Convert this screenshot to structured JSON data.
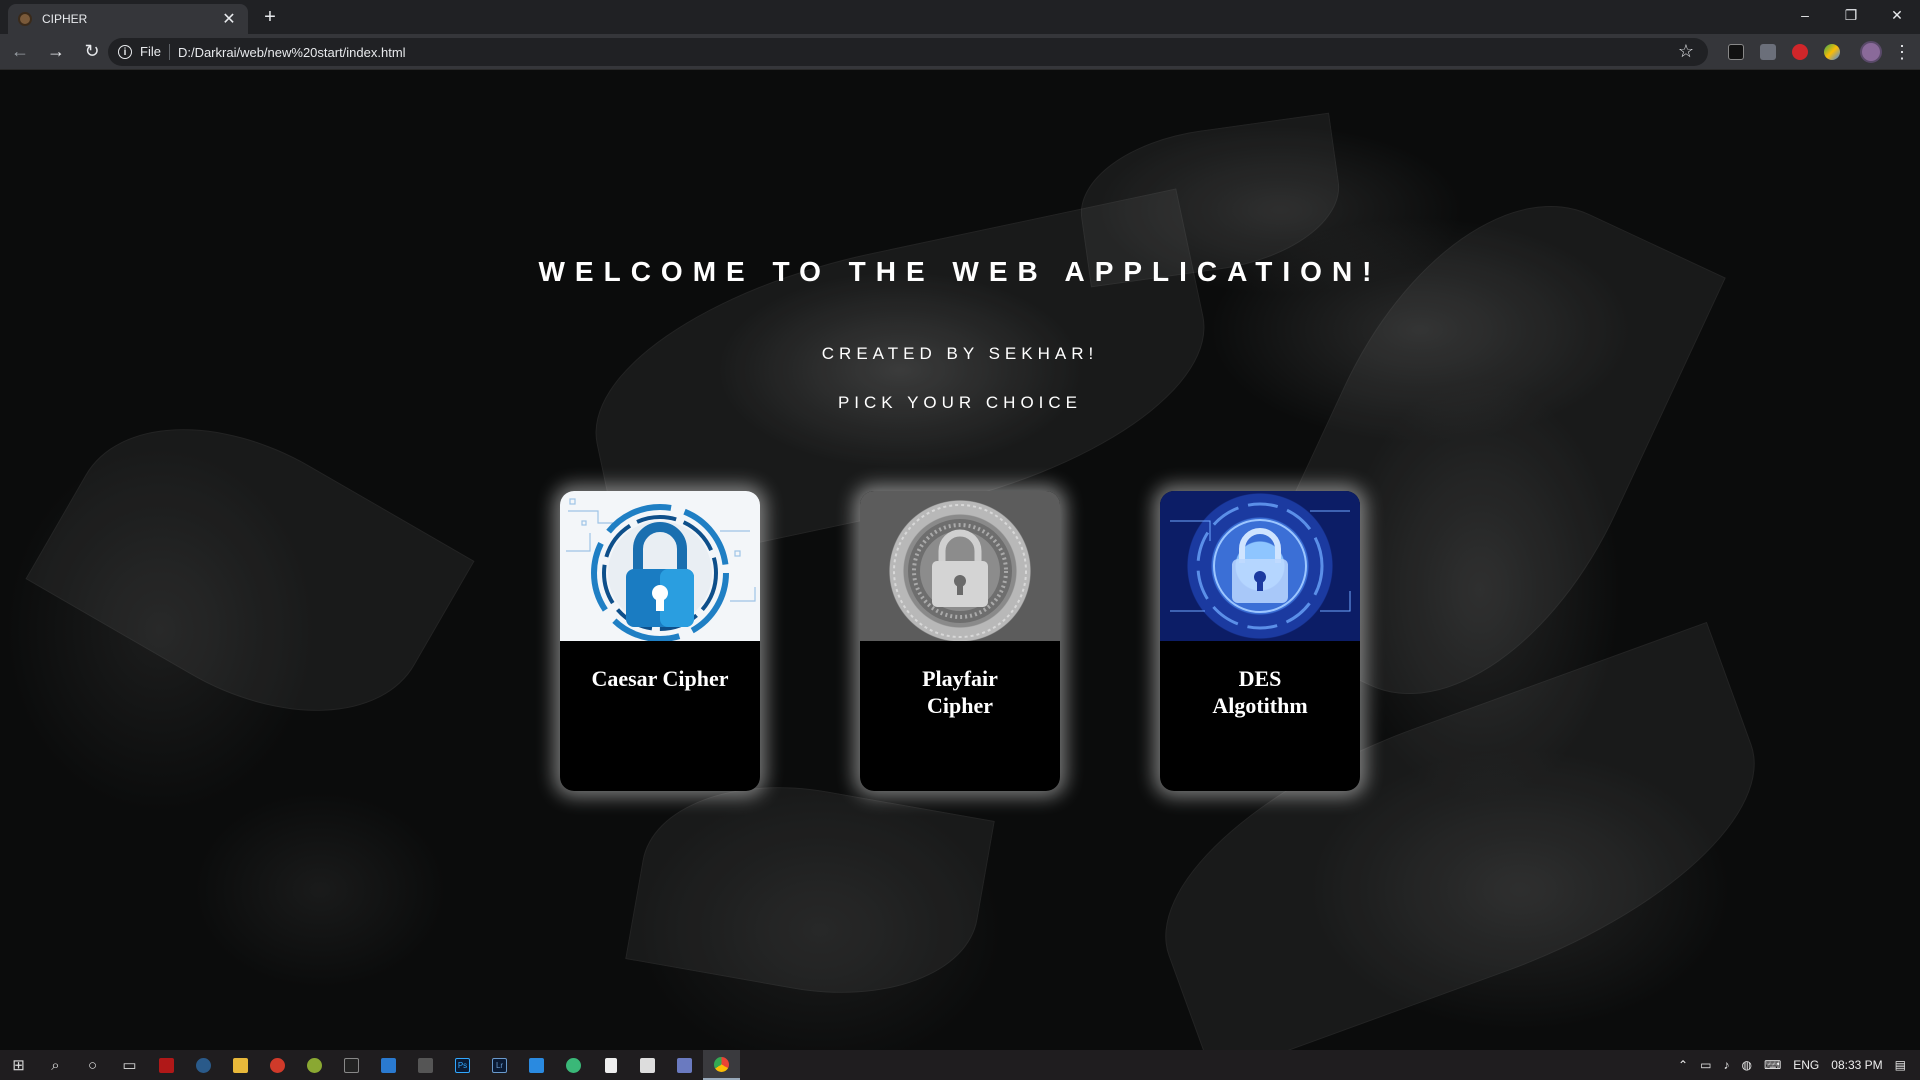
{
  "browser": {
    "tab_title": "CIPHER",
    "tab_close": "✕",
    "new_tab": "+",
    "window_controls": {
      "minimize": "–",
      "restore": "❐",
      "close": "✕"
    },
    "nav": {
      "back": "←",
      "forward": "→",
      "reload": "↻"
    },
    "address": {
      "scheme": "File",
      "url": "D:/Darkrai/web/new%20start/index.html"
    },
    "star": "☆",
    "menu": "⋮"
  },
  "page": {
    "welcome": "WELCOME TO THE WEB APPLICATION!",
    "created_by": "CREATED BY SEKHAR!",
    "pick": "PICK YOUR CHOICE",
    "cards": [
      {
        "title": "Caesar Cipher",
        "icon": "blue-padlock-icon"
      },
      {
        "title": "Playfair Cipher",
        "icon": "silver-padlock-coin-icon"
      },
      {
        "title": "DES Algotithm",
        "icon": "blue-circuit-padlock-icon"
      }
    ]
  },
  "taskbar": {
    "icons": [
      "windows-start-icon",
      "search-icon",
      "cortana-icon",
      "task-view-icon",
      "app-red-icon",
      "steam-icon",
      "file-explorer-icon",
      "app-p-icon",
      "app-green-icon",
      "app-terminal-icon",
      "app-store-icon",
      "app-code-icon",
      "photoshop-icon",
      "lightroom-icon",
      "vscode-icon",
      "app-green2-icon",
      "file-icon",
      "app-unity-icon",
      "app-cube-icon",
      "chrome-icon"
    ],
    "labels": {
      "photoshop": "Ps",
      "lightroom": "Lr"
    },
    "tray": {
      "language": "ENG",
      "time": "08:33 PM"
    }
  },
  "colors": {
    "card_glow": "#ffffff",
    "chrome_dark": "#202124",
    "chrome_toolbar": "#35363a"
  }
}
